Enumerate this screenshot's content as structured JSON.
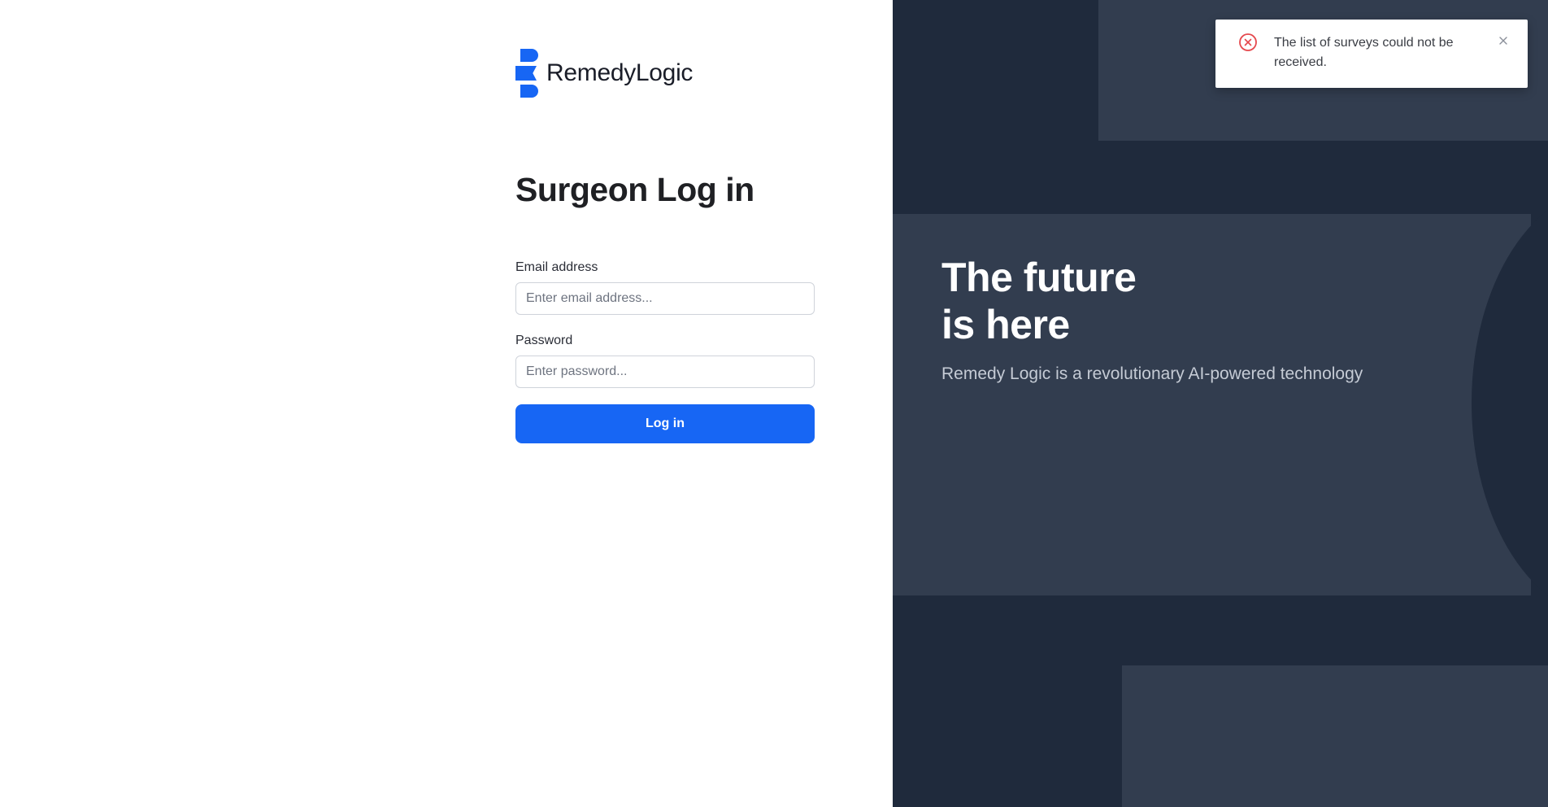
{
  "brand": {
    "name": "RemedyLogic",
    "color": "#1766f4"
  },
  "login": {
    "title": "Surgeon Log in",
    "email_label": "Email address",
    "email_placeholder": "Enter email address...",
    "email_value": "",
    "password_label": "Password",
    "password_placeholder": "Enter password...",
    "password_value": "",
    "submit_label": "Log in"
  },
  "hero": {
    "title_line1": "The future",
    "title_line2": "is here",
    "subtitle": "Remedy Logic is a revolutionary AI-powered technology"
  },
  "toast": {
    "type": "error",
    "icon": "error-circle-icon",
    "message": "The list of surveys could not be received.",
    "close_icon": "close-icon",
    "accent_color": "#e5484d"
  },
  "colors": {
    "panel_dark": "#1f2a3c",
    "panel_shape": "#323d4f",
    "button": "#1766f4"
  }
}
